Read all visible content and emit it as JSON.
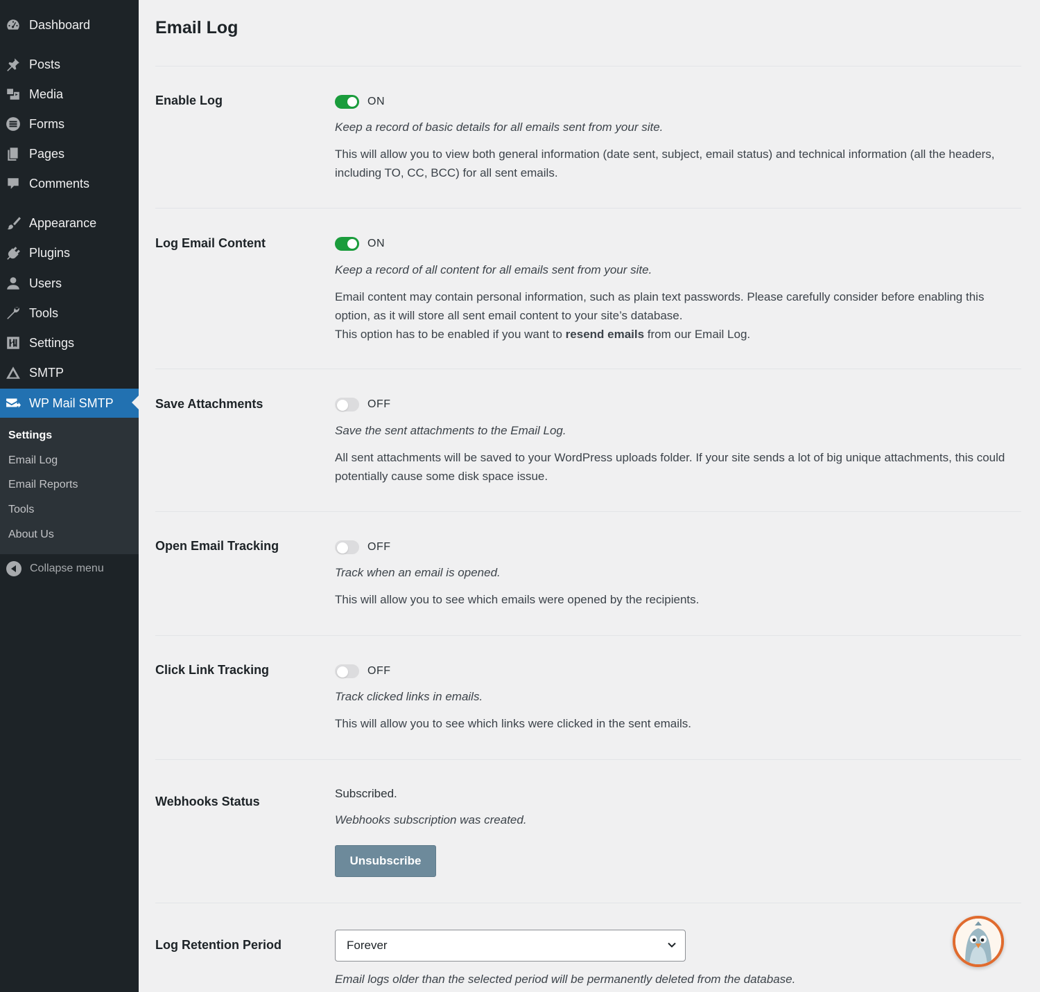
{
  "sidebar": {
    "items": [
      {
        "label": "Dashboard",
        "icon": "dashboard-icon"
      },
      {
        "label": "Posts",
        "icon": "pin-icon"
      },
      {
        "label": "Media",
        "icon": "media-icon"
      },
      {
        "label": "Forms",
        "icon": "forms-icon"
      },
      {
        "label": "Pages",
        "icon": "pages-icon"
      },
      {
        "label": "Comments",
        "icon": "comment-icon"
      },
      {
        "label": "Appearance",
        "icon": "brush-icon"
      },
      {
        "label": "Plugins",
        "icon": "plugin-icon"
      },
      {
        "label": "Users",
        "icon": "user-icon"
      },
      {
        "label": "Tools",
        "icon": "wrench-icon"
      },
      {
        "label": "Settings",
        "icon": "sliders-icon"
      },
      {
        "label": "SMTP",
        "icon": "smtp-icon"
      },
      {
        "label": "WP Mail SMTP",
        "icon": "mail-smtp-icon"
      }
    ],
    "submenu": [
      "Settings",
      "Email Log",
      "Email Reports",
      "Tools",
      "About Us"
    ],
    "collapse_label": "Collapse menu"
  },
  "page": {
    "title": "Email Log"
  },
  "settings": {
    "enable_log": {
      "label": "Enable Log",
      "state": "ON",
      "italic": "Keep a record of basic details for all emails sent from your site.",
      "desc": "This will allow you to view both general information (date sent, subject, email status) and technical information (all the headers, including TO, CC, BCC) for all sent emails."
    },
    "log_content": {
      "label": "Log Email Content",
      "state": "ON",
      "italic": "Keep a record of all content for all emails sent from your site.",
      "desc_1": "Email content may contain personal information, such as plain text passwords. Please carefully consider before enabling this option, as it will store all sent email content to your site’s database.",
      "desc_2_pre": "This option has to be enabled if you want to ",
      "desc_2_bold": "resend emails",
      "desc_2_post": " from our Email Log."
    },
    "save_attachments": {
      "label": "Save Attachments",
      "state": "OFF",
      "italic": "Save the sent attachments to the Email Log.",
      "desc": "All sent attachments will be saved to your WordPress uploads folder. If your site sends a lot of big unique attachments, this could potentially cause some disk space issue."
    },
    "open_tracking": {
      "label": "Open Email Tracking",
      "state": "OFF",
      "italic": "Track when an email is opened.",
      "desc": "This will allow you to see which emails were opened by the recipients."
    },
    "click_tracking": {
      "label": "Click Link Tracking",
      "state": "OFF",
      "italic": "Track clicked links in emails.",
      "desc": "This will allow you to see which links were clicked in the sent emails."
    },
    "webhooks": {
      "label": "Webhooks Status",
      "status": "Subscribed.",
      "italic": "Webhooks subscription was created.",
      "button": "Unsubscribe"
    },
    "retention": {
      "label": "Log Retention Period",
      "selected": "Forever",
      "italic": "Email logs older than the selected period will be permanently deleted from the database."
    }
  },
  "colors": {
    "sidebar_bg": "#1d2327",
    "accent": "#2271b1",
    "toggle_on": "#1a9c3c",
    "mascot_ring": "#e06b2e"
  }
}
